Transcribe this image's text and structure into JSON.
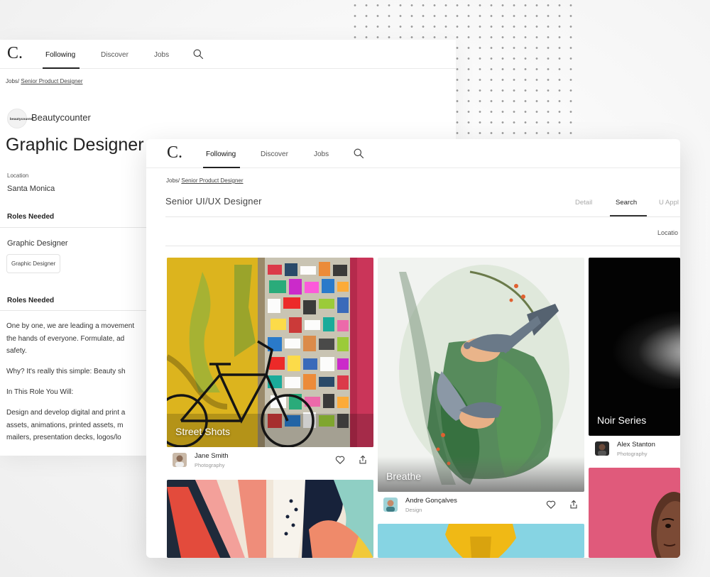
{
  "nav": {
    "logo": "C.",
    "links": [
      "Following",
      "Discover",
      "Jobs"
    ]
  },
  "back_page": {
    "breadcrumb_root": "Jobs/",
    "breadcrumb_link": "Senior Product Designer",
    "brand_logo_text": "beautycounter",
    "brand_name": "Beautycounter",
    "job_title": "Graphic Designer",
    "location_label": "Location",
    "location_value": "Santa Monica",
    "roles_heading_1": "Roles Needed",
    "role_name": "Graphic Designer",
    "role_chip": "Graphic Designer",
    "roles_heading_2": "Roles Needed",
    "paragraphs": [
      "One by one, we are leading a movement",
      "the hands of everyone. Formulate, ad",
      "safety.",
      "Why? It's really this simple: Beauty sh",
      "In This Role You Will:",
      "Design and develop digital and print a",
      "assets, animations, printed assets, m",
      "mailers, presentation decks, logos/lo"
    ]
  },
  "front_page": {
    "breadcrumb_root": "Jobs/",
    "breadcrumb_link": "Senior Product Designer",
    "title": "Senior UI/UX Designer",
    "tabs": [
      "Detail",
      "Search",
      "U Appl"
    ],
    "filter_label": "Locatio",
    "cards": [
      {
        "caption": "Street Shots",
        "author": "Jane Smith",
        "role": "Photography"
      },
      {
        "caption": "Breathe",
        "author": "Andre Gonçalves",
        "role": "Design"
      },
      {
        "caption": "Noir Series",
        "author": "Alex Stanton",
        "role": "Photography"
      }
    ]
  },
  "colors": {
    "accent_text": "#222222",
    "muted_text": "#999999",
    "street_yellow": "#d9b21c",
    "breathe_green": "#4e8a4f",
    "noir_black": "#050505",
    "pink": "#e05a7b",
    "cyan": "#7fd1e0"
  },
  "icons": [
    "search-icon",
    "heart-icon",
    "share-icon"
  ]
}
